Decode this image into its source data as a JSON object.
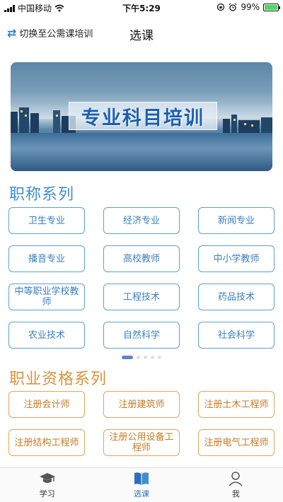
{
  "status": {
    "carrier": "中国移动",
    "time": "下午5:29",
    "battery": "99%",
    "battery_level": 0.99
  },
  "nav": {
    "switch_label": "切换至公需课培训",
    "title": "选课"
  },
  "banner": {
    "title": "专业科目培训"
  },
  "section1": {
    "title": "职称系列",
    "items": [
      "卫生专业",
      "经济专业",
      "新闻专业",
      "播音专业",
      "高校教师",
      "中小学教师",
      "中等职业学校教师",
      "工程技术",
      "药品技术",
      "农业技术",
      "自然科学",
      "社会科学"
    ]
  },
  "pager": {
    "active_index": 0,
    "count": 5
  },
  "section2": {
    "title": "职业资格系列",
    "items": [
      "注册会计师",
      "注册建筑师",
      "注册土木工程师",
      "注册结构工程师",
      "注册公用设备工程师",
      "注册电气工程师"
    ]
  },
  "tabs": [
    {
      "label": "学习",
      "icon": "graduation-cap-icon"
    },
    {
      "label": "选课",
      "icon": "book-icon"
    },
    {
      "label": "我",
      "icon": "user-icon"
    }
  ],
  "colors": {
    "accent_blue": "#3f8ed1",
    "accent_orange": "#d8923a",
    "tab_active": "#2a6fc0"
  }
}
